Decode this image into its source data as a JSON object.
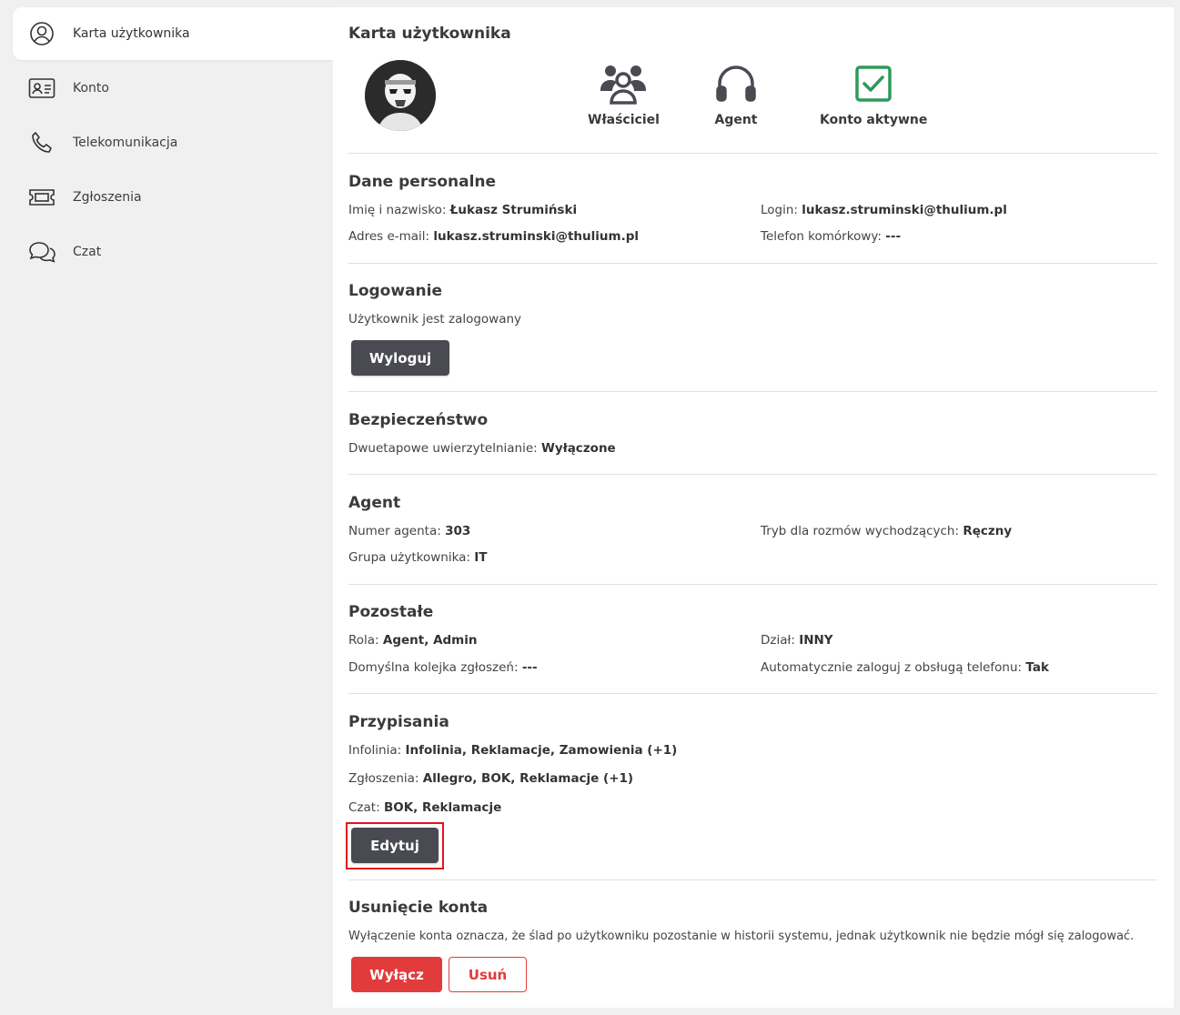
{
  "sidebar": {
    "items": [
      {
        "label": "Karta użytkownika",
        "icon": "user-circle-icon",
        "active": true
      },
      {
        "label": "Konto",
        "icon": "id-card-icon"
      },
      {
        "label": "Telekomunikacja",
        "icon": "phone-icon"
      },
      {
        "label": "Zgłoszenia",
        "icon": "ticket-icon"
      },
      {
        "label": "Czat",
        "icon": "chat-bubbles-icon"
      }
    ]
  },
  "card": {
    "title": "Karta użytkownika",
    "badges": [
      {
        "label": "Właściciel",
        "icon": "users-group-icon"
      },
      {
        "label": "Agent",
        "icon": "headset-icon"
      },
      {
        "label": "Konto aktywne",
        "icon": "checkbox-checked-icon",
        "color": "#2e9a5a"
      }
    ]
  },
  "personal": {
    "title": "Dane personalne",
    "name_label": "Imię i nazwisko:",
    "name_value": "Łukasz Strumiński",
    "login_label": "Login:",
    "login_value": "lukasz.struminski@thulium.pl",
    "email_label": "Adres e-mail:",
    "email_value": "lukasz.struminski@thulium.pl",
    "phone_label": "Telefon komórkowy:",
    "phone_value": "---"
  },
  "login_section": {
    "title": "Logowanie",
    "status": "Użytkownik jest zalogowany",
    "logout_button": "Wyloguj"
  },
  "security": {
    "title": "Bezpieczeństwo",
    "twofa_label": "Dwuetapowe uwierzytelnianie:",
    "twofa_value": "Wyłączone"
  },
  "agent": {
    "title": "Agent",
    "number_label": "Numer agenta:",
    "number_value": "303",
    "mode_label": "Tryb dla rozmów wychodzących:",
    "mode_value": "Ręczny",
    "group_label": "Grupa użytkownika:",
    "group_value": "IT"
  },
  "other": {
    "title": "Pozostałe",
    "role_label": "Rola:",
    "role_value": "Agent, Admin",
    "dept_label": "Dział:",
    "dept_value": "INNY",
    "queue_label": "Domyślna kolejka zgłoszeń:",
    "queue_value": "---",
    "autologin_label": "Automatycznie zaloguj z obsługą telefonu:",
    "autologin_value": "Tak"
  },
  "assignments": {
    "title": "Przypisania",
    "infoline_label": "Infolinia:",
    "infoline_value": "Infolinia, Reklamacje, Zamowienia (+1)",
    "tickets_label": "Zgłoszenia:",
    "tickets_value": "Allegro, BOK, Reklamacje (+1)",
    "chat_label": "Czat:",
    "chat_value": "BOK, Reklamacje",
    "edit_button": "Edytuj"
  },
  "deletion": {
    "title": "Usunięcie konta",
    "description": "Wyłączenie konta oznacza, że ślad po użytkowniku pozostanie w historii systemu, jednak użytkownik nie będzie mógł się zalogować.",
    "disable_button": "Wyłącz",
    "delete_button": "Usuń"
  },
  "colors": {
    "accent_red": "#e23b3b",
    "dark_button": "#4a4b52",
    "active_green": "#2e9a5a",
    "highlight": "#e5141c"
  }
}
